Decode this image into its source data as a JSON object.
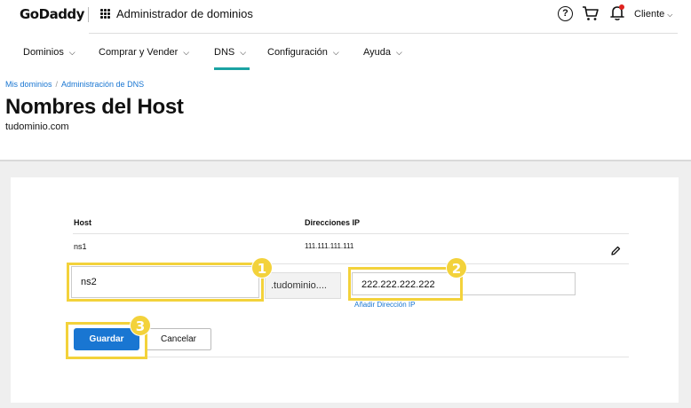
{
  "header": {
    "logo": "GoDaddy",
    "app_title": "Administrador de dominios",
    "client_label": "Cliente",
    "help_glyph": "?"
  },
  "nav": {
    "items": [
      {
        "label": "Dominios"
      },
      {
        "label": "Comprar y Vender"
      },
      {
        "label": "DNS"
      },
      {
        "label": "Configuración"
      },
      {
        "label": "Ayuda"
      }
    ],
    "active": "DNS",
    "accent_color": "#1ba3a3"
  },
  "breadcrumb": {
    "items": [
      "Mis dominios",
      "Administración de DNS"
    ],
    "separator": "/"
  },
  "page": {
    "title": "Nombres del Host",
    "subtitle": "tudominio.com"
  },
  "table": {
    "headers": {
      "host": "Host",
      "ips": "Direcciones IP"
    },
    "rows": [
      {
        "host": "ns1",
        "ip": "111.111.111.111"
      }
    ]
  },
  "form": {
    "host_value": "ns2",
    "domain_suffix": ".tudominio....",
    "ip_value": "222.222.222.222",
    "add_ip_label": "Añadir Dirección IP",
    "save_label": "Guardar",
    "cancel_label": "Cancelar"
  },
  "steps": [
    "1",
    "2",
    "3"
  ],
  "colors": {
    "primary": "#1976d2",
    "highlight": "#f3d23b",
    "notification": "#e0221e"
  }
}
